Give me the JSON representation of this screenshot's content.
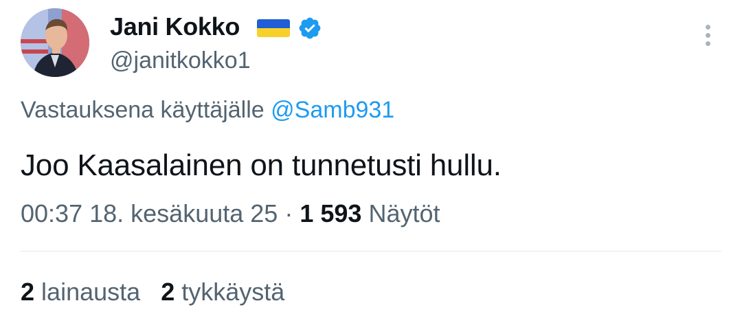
{
  "tweet": {
    "author": {
      "display_name": "Jani Kokko",
      "handle": "@janitkokko1",
      "flag_icon": "ukraine-flag-icon",
      "verified_icon": "verified-badge-icon",
      "verified_color": "#1d9bf0"
    },
    "reply_context": {
      "prefix": "Vastauksena käyttäjälle",
      "mention": "@Samb931"
    },
    "text": "Joo Kaasalainen on tunnetusti hullu.",
    "meta": {
      "time": "00:37",
      "date": "18. kesäkuuta 25",
      "separator": "·",
      "views_count": "1 593",
      "views_label": "Näytöt"
    },
    "stats": {
      "quotes_count": "2",
      "quotes_label": "lainausta",
      "likes_count": "2",
      "likes_label": "tykkäystä"
    }
  },
  "colors": {
    "text_primary": "#0f1419",
    "text_secondary": "#536471",
    "accent": "#1d9bf0",
    "flag_blue": "#1f5ed6",
    "flag_yellow": "#f7d12a"
  }
}
